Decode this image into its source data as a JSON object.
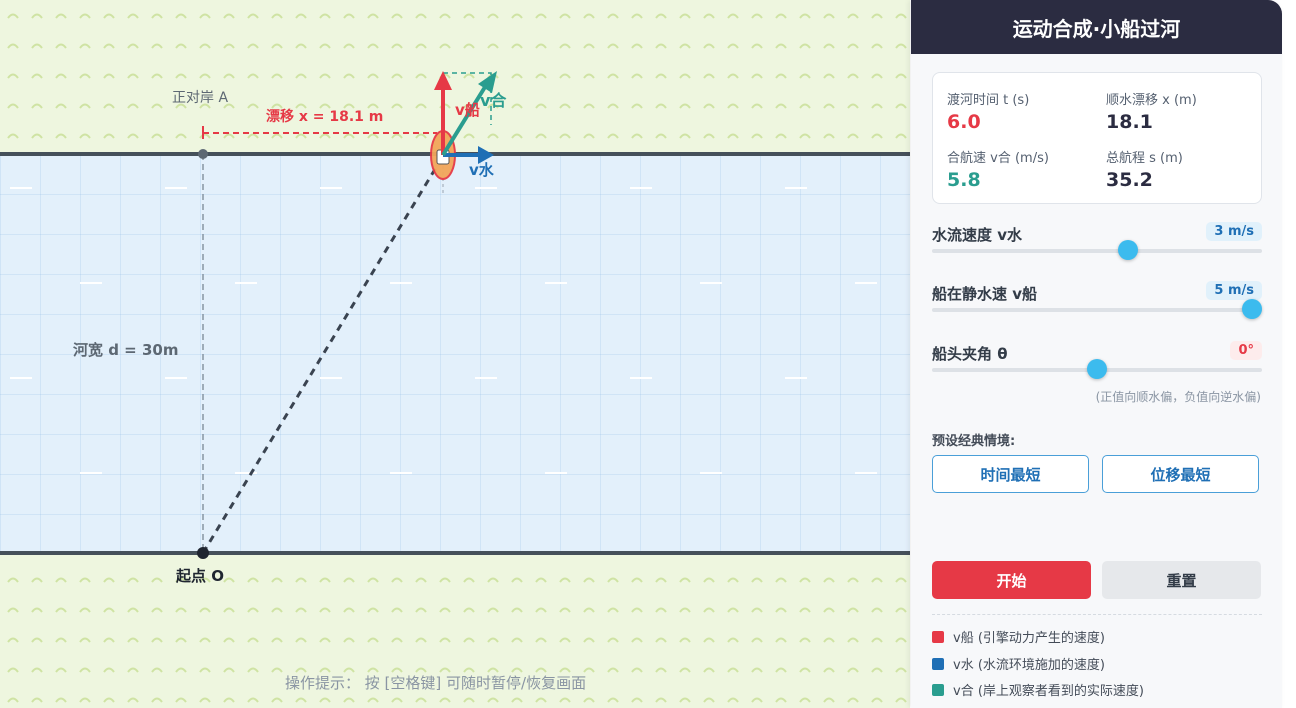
{
  "colors": {
    "v_boat": "#e63946",
    "v_water": "#1f6fb5",
    "v_result": "#2a9d8f",
    "bank": "#45505a",
    "header_bg": "#2b2c41",
    "start_button": "#e63946"
  },
  "scene": {
    "opposite_label": "正对岸 A",
    "drift_label": "漂移 x = 18.1 m",
    "width_label": "河宽 d = 30m",
    "start_label": "起点 O",
    "v_boat_label": "v船",
    "v_water_label": "v水",
    "v_result_label": "v合",
    "hint": "操作提示： 按 [空格键] 可随时暂停/恢复画面"
  },
  "panel": {
    "title": "运动合成·小船过河",
    "stats": {
      "time": {
        "label": "渡河时间 t (s)",
        "value": "6.0"
      },
      "drift": {
        "label": "顺水漂移 x (m)",
        "value": "18.1"
      },
      "speed": {
        "label": "合航速 v合 (m/s)",
        "value": "5.8"
      },
      "path": {
        "label": "总航程 s (m)",
        "value": "35.2"
      }
    },
    "controls": {
      "water": {
        "label": "水流速度 v水",
        "value": "3 m/s",
        "level": 0.6
      },
      "boat": {
        "label": "船在静水速 v船",
        "value": "5 m/s",
        "level": 1.0
      },
      "angle": {
        "label": "船头夹角 θ",
        "value": "0°",
        "level": 0.5,
        "note": "(正值向顺水偏，负值向逆水偏)"
      }
    },
    "preset_title": "预设经典情境:",
    "presets": [
      "时间最短",
      "位移最短"
    ],
    "start_button": "开始",
    "reset_button": "重置",
    "legend": [
      {
        "text": "v船 (引擎动力产生的速度)",
        "color": "#e63946"
      },
      {
        "text": "v水 (水流环境施加的速度)",
        "color": "#1f6fb5"
      },
      {
        "text": "v合 (岸上观察者看到的实际速度)",
        "color": "#2a9d8f"
      }
    ]
  }
}
